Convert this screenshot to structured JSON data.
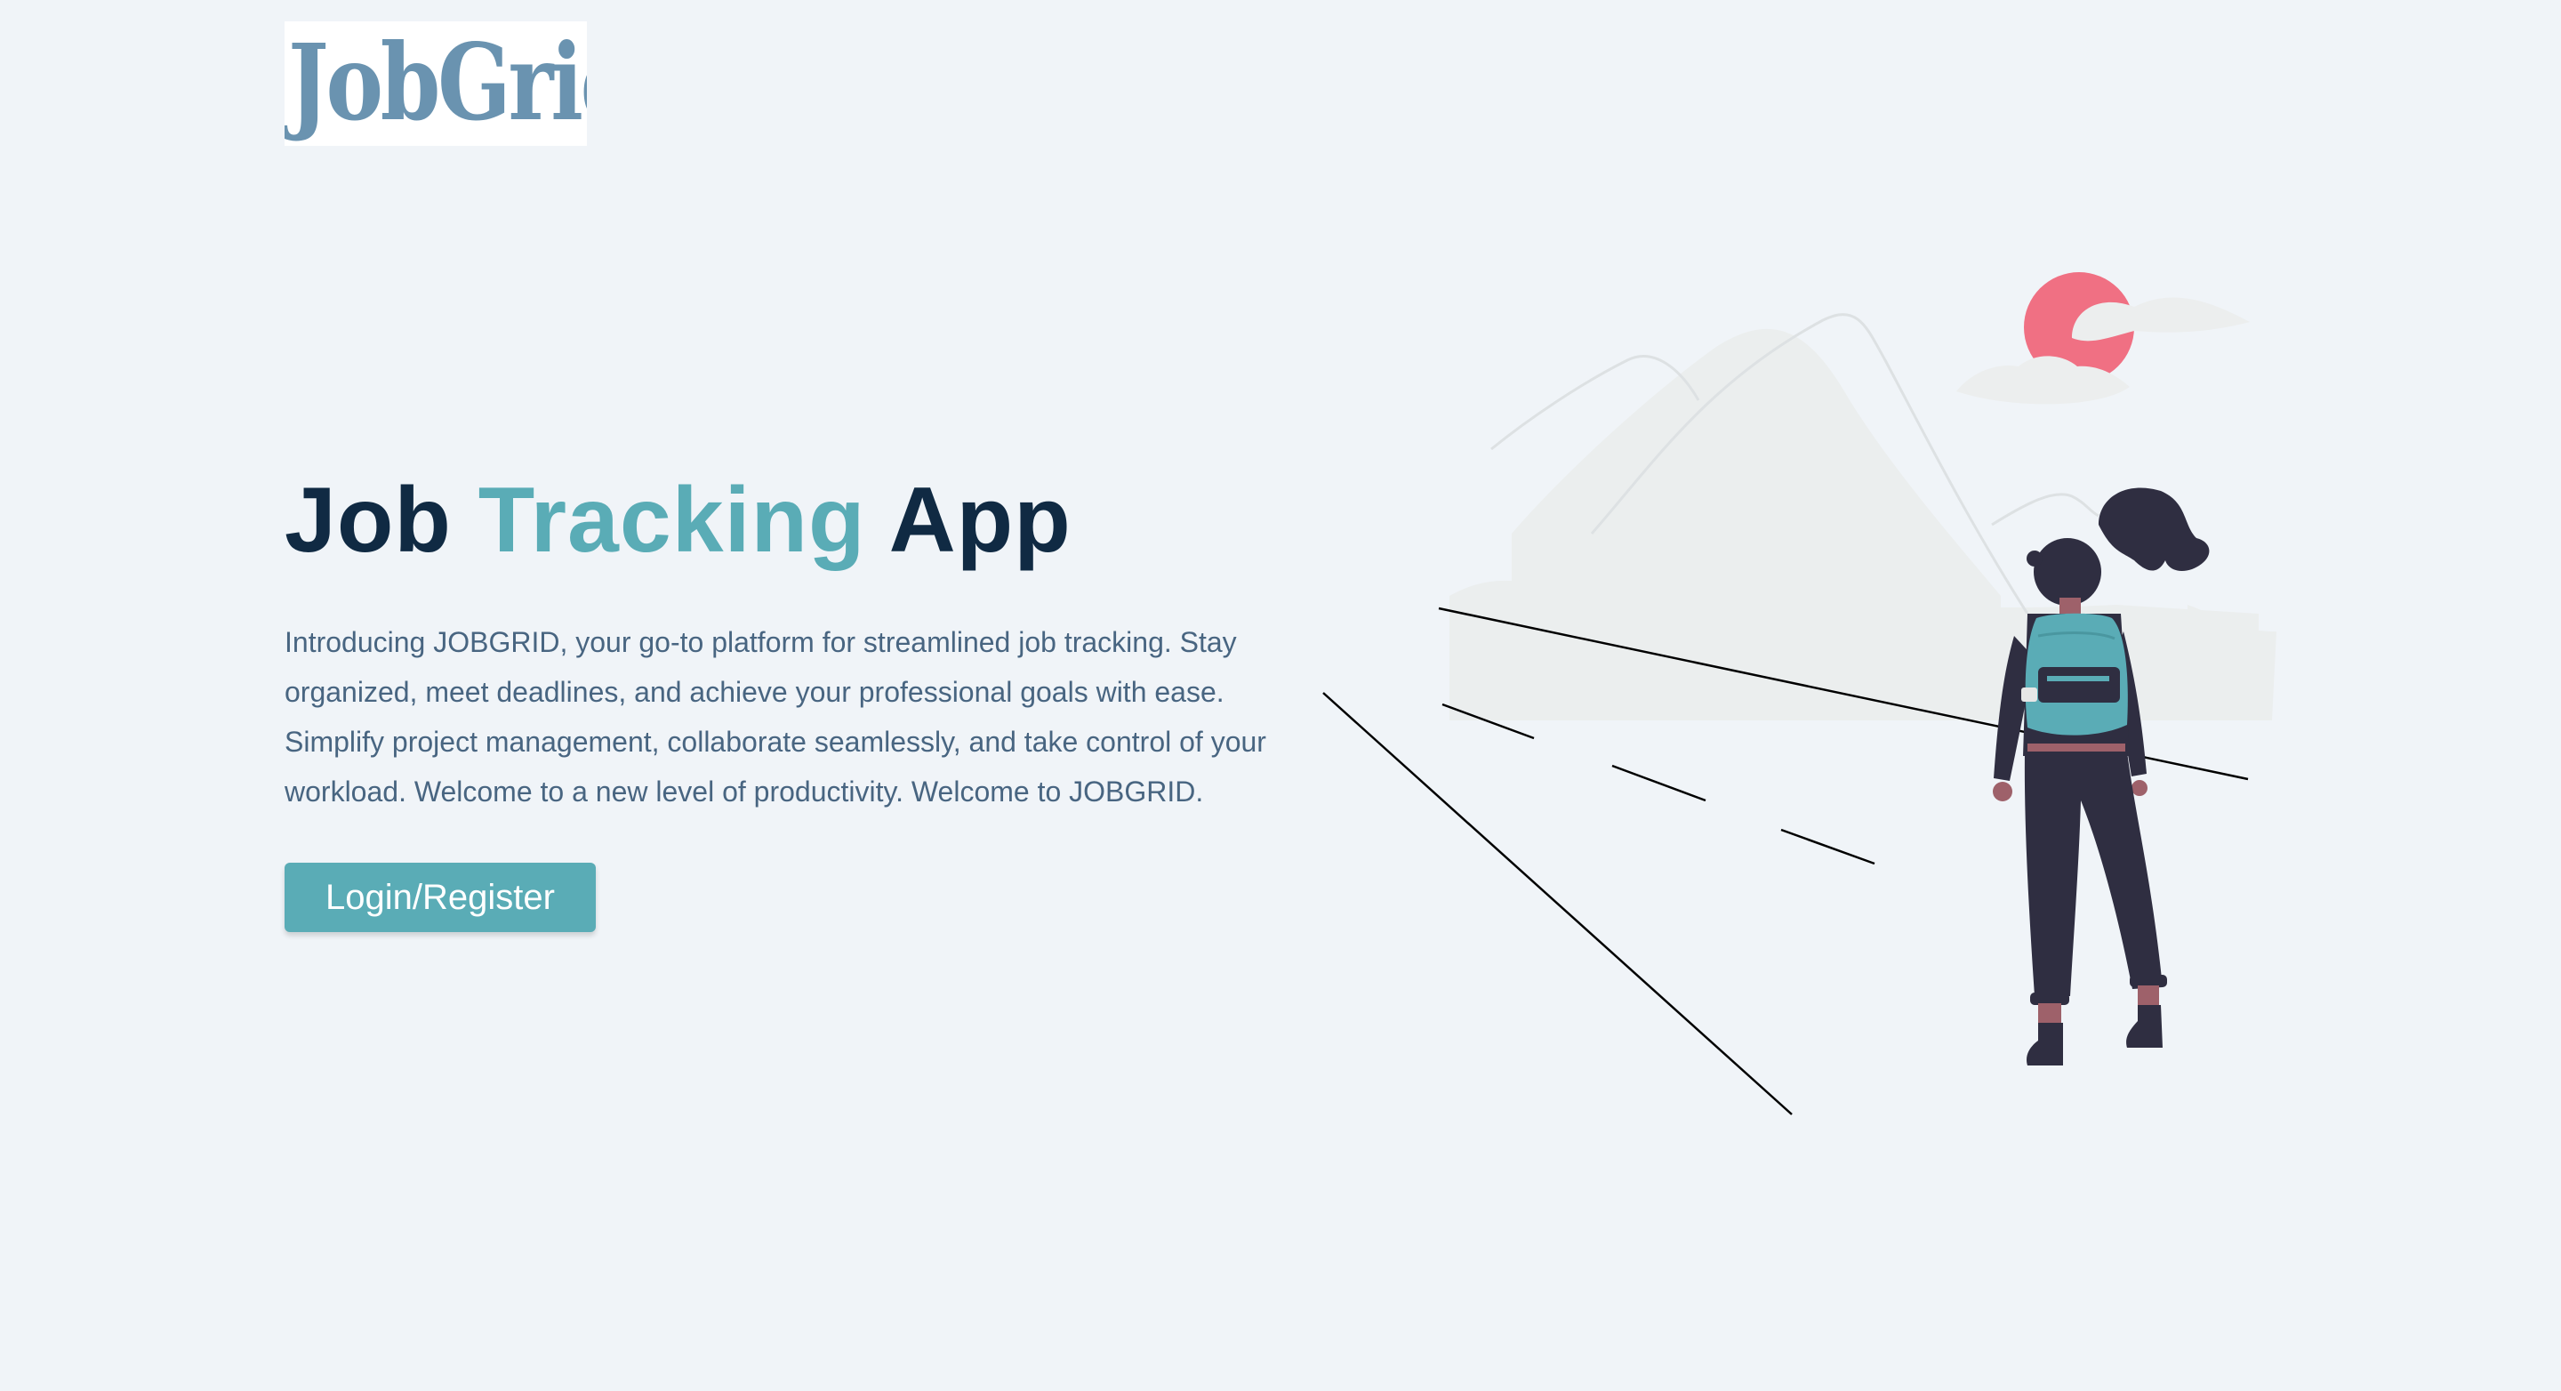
{
  "brand": {
    "logo_text": "JobGrid"
  },
  "hero": {
    "title_part1": "Job ",
    "title_accent": "Tracking",
    "title_part2": " App",
    "description": "Introducing JOBGRID, your go-to platform for streamlined job tracking. Stay organized, meet deadlines, and achieve your professional goals with ease. Simplify project management, collaborate seamlessly, and take control of your workload. Welcome to a new level of productivity. Welcome to JOBGRID.",
    "cta_label": "Login/Register"
  },
  "colors": {
    "background": "#f0f4f8",
    "primary": "#5aacb6",
    "heading": "#102a43",
    "body_text": "#486581",
    "logo": "#6a93b0",
    "sun": "#f07083",
    "figure_dark": "#2f2e41"
  },
  "illustration": {
    "name": "woman-hiker-on-road-illustration"
  }
}
